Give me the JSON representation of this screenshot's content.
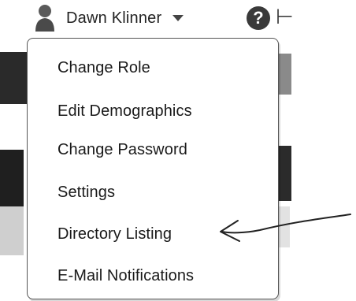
{
  "header": {
    "user_name": "Dawn Klinner",
    "user_icon": "user-icon",
    "caret_icon": "chevron-down-icon",
    "help_icon": "help-icon",
    "help_glyph": "?",
    "trail_glyph": "⊢"
  },
  "menu": {
    "items": [
      {
        "label": "Change Role"
      },
      {
        "label": "Edit Demographics"
      },
      {
        "label": "Change Password"
      },
      {
        "label": "Settings"
      },
      {
        "label": "Directory Listing"
      },
      {
        "label": "E-Mail Notifications"
      }
    ]
  },
  "annotation": {
    "type": "hand-drawn-arrow",
    "points_to": "Directory Listing"
  }
}
